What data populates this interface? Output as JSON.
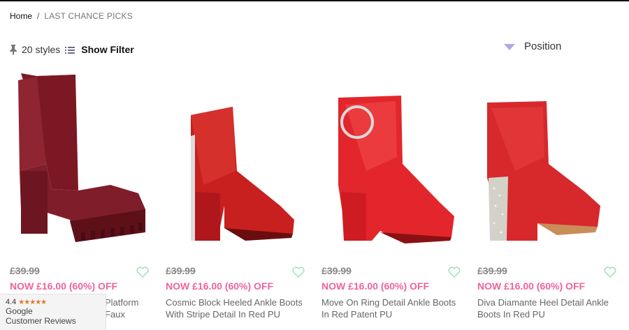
{
  "breadcrumb": {
    "home": "Home",
    "separator": "/",
    "current": "LAST CHANCE PICKS"
  },
  "toolbar": {
    "count": "20 styles",
    "filter_label": "Show Filter"
  },
  "sort": {
    "label": "Position"
  },
  "colors": {
    "accent_pink": "#f0639a",
    "heart_green": "#9be3b5",
    "sort_arrow": "#b6a6e2"
  },
  "products": [
    {
      "old_price": "£39.99",
      "now_price": "NOW £16.00 (60%) OFF",
      "name": "Platform\nFaux",
      "image": "burgundy-platform-boot"
    },
    {
      "old_price": "£39.99",
      "now_price": "NOW £16.00 (60%) OFF",
      "name": "Cosmic Block Heeled Ankle Boots With Stripe Detail In Red PU",
      "image": "red-stripe-ankle-boot"
    },
    {
      "old_price": "£39.99",
      "now_price": "NOW £16.00 (60%) OFF",
      "name": "Move On Ring Detail Ankle Boots In Red Patent PU",
      "image": "red-patent-ring-boot"
    },
    {
      "old_price": "£39.99",
      "now_price": "NOW £16.00 (60%) OFF",
      "name": "Diva Diamante Heel Detail Ankle Boots In Red PU",
      "image": "red-diamante-heel-boot"
    }
  ],
  "reviews_badge": {
    "rating": "4.4",
    "stars": "★★★★★",
    "brand": "Google",
    "label": "Customer Reviews"
  }
}
